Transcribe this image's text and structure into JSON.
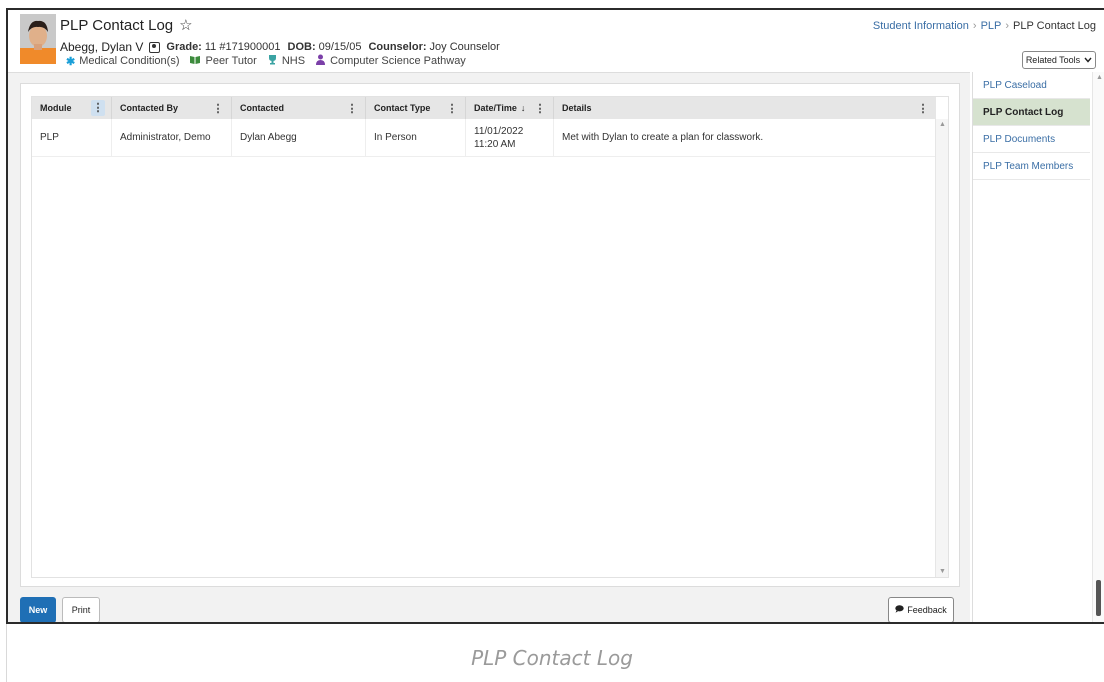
{
  "header": {
    "title": "PLP Contact Log",
    "student_name": "Abegg, Dylan V",
    "grade_label": "Grade:",
    "grade_value": "11 #171900001",
    "dob_label": "DOB:",
    "dob_value": "09/15/05",
    "counselor_label": "Counselor:",
    "counselor_value": "Joy Counselor",
    "flags": [
      {
        "label": "Medical Condition(s)",
        "icon": "asterisk-icon",
        "color": "#1a9fd8"
      },
      {
        "label": "Peer Tutor",
        "icon": "book-icon",
        "color": "#3d8b3d"
      },
      {
        "label": "NHS",
        "icon": "trophy-icon",
        "color": "#3aa3a3"
      },
      {
        "label": "Computer Science Pathway",
        "icon": "person-icon",
        "color": "#7b3fa8"
      }
    ]
  },
  "breadcrumb": {
    "item1": "Student Information",
    "item2": "PLP",
    "current": "PLP Contact Log"
  },
  "related_tools": "Related Tools",
  "grid": {
    "columns": [
      "Module",
      "Contacted By",
      "Contacted",
      "Contact Type",
      "Date/Time",
      "Details"
    ],
    "rows": [
      {
        "module": "PLP",
        "contacted_by": "Administrator, Demo",
        "contacted": "Dylan Abegg",
        "contact_type": "In Person",
        "date": "11/01/2022",
        "time": "11:20 AM",
        "details": "Met with Dylan to create a plan for classwork."
      }
    ]
  },
  "actions": {
    "new": "New",
    "print": "Print",
    "feedback": "Feedback"
  },
  "side_nav": {
    "items": [
      "PLP Caseload",
      "PLP Contact Log",
      "PLP Documents",
      "PLP Team Members"
    ],
    "active": "PLP Contact Log"
  },
  "caption": "PLP Contact Log",
  "colors": {
    "primary_button": "#1f6fb5",
    "active_nav": "#d6e2cf",
    "link": "#3a6ea5"
  }
}
